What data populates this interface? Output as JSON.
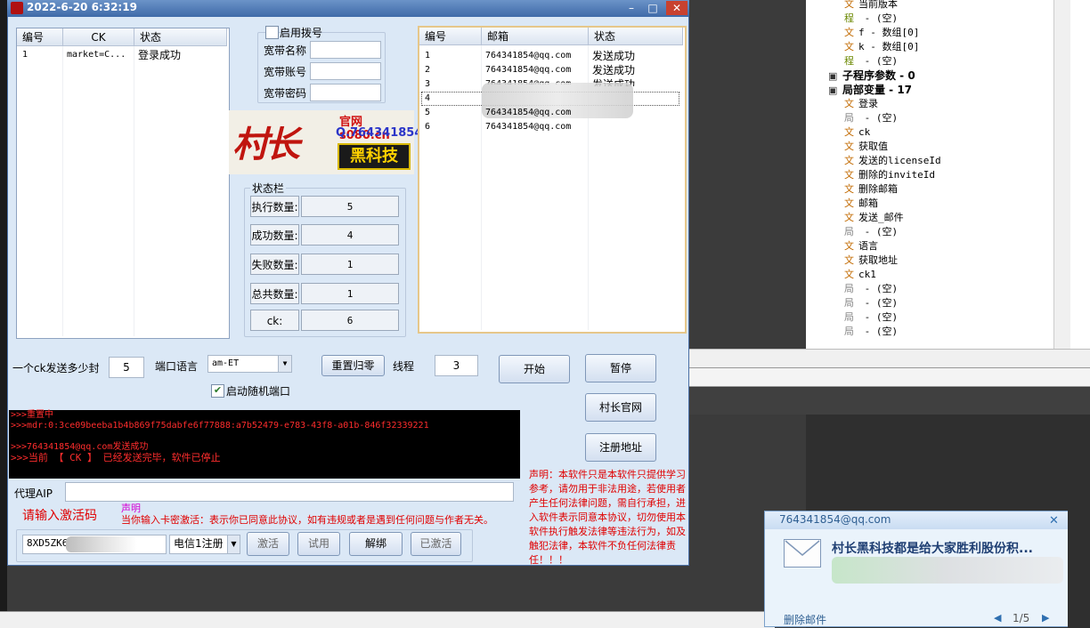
{
  "window": {
    "title": "2022-6-20 6:32:19"
  },
  "ide_tree": [
    {
      "icon": "文",
      "text": "当前版本",
      "type": "str"
    },
    {
      "icon": "程",
      "text": " - (空)",
      "type": "prog"
    },
    {
      "icon": "文",
      "text": "f - 数组[0]",
      "type": "str"
    },
    {
      "icon": "文",
      "text": "k - 数组[0]",
      "type": "str"
    },
    {
      "icon": "程",
      "text": " - (空)",
      "type": "prog"
    },
    {
      "icon": "",
      "text": "子程序参数 - 0",
      "type": "bold"
    },
    {
      "icon": "",
      "text": "局部变量 - 17",
      "type": "bold"
    },
    {
      "icon": "文",
      "text": "登录",
      "type": "str"
    },
    {
      "icon": "局",
      "text": " - (空)",
      "type": "loc"
    },
    {
      "icon": "文",
      "text": "ck",
      "type": "str"
    },
    {
      "icon": "文",
      "text": "获取值",
      "type": "str"
    },
    {
      "icon": "文",
      "text": "发送的licenseId",
      "type": "str"
    },
    {
      "icon": "文",
      "text": "删除的inviteId",
      "type": "str"
    },
    {
      "icon": "文",
      "text": "删除邮箱",
      "type": "str"
    },
    {
      "icon": "文",
      "text": "邮箱",
      "type": "str"
    },
    {
      "icon": "文",
      "text": "发送_邮件",
      "type": "str"
    },
    {
      "icon": "局",
      "text": " - (空)",
      "type": "loc"
    },
    {
      "icon": "文",
      "text": "语言",
      "type": "str"
    },
    {
      "icon": "文",
      "text": "获取地址",
      "type": "str"
    },
    {
      "icon": "文",
      "text": "ck1",
      "type": "str"
    },
    {
      "icon": "局",
      "text": " - (空)",
      "type": "loc"
    },
    {
      "icon": "局",
      "text": " - (空)",
      "type": "loc"
    },
    {
      "icon": "局",
      "text": " - (空)",
      "type": "loc"
    },
    {
      "icon": "局",
      "text": " - (空)",
      "type": "loc"
    }
  ],
  "ck_table": {
    "headers": [
      "编号",
      "CK",
      "状态"
    ],
    "rows": [
      [
        "1",
        "market=C...",
        "登录成功"
      ]
    ]
  },
  "dial": {
    "enable_label": "启用拨号",
    "name_label": "宽带名称",
    "account_label": "宽带账号",
    "password_label": "宽带密码"
  },
  "logo": {
    "site": "官网 s080.cn",
    "qq": "Q.764341854",
    "brand": "村长",
    "tagline": "黑科技"
  },
  "status": {
    "title": "状态栏",
    "items": [
      {
        "label": "执行数量:",
        "value": "5"
      },
      {
        "label": "成功数量:",
        "value": "4"
      },
      {
        "label": "失败数量:",
        "value": "1"
      },
      {
        "label": "总共数量:",
        "value": "1"
      },
      {
        "label": "ck:",
        "value": "6"
      }
    ]
  },
  "mail_table": {
    "headers": [
      "编号",
      "邮箱",
      "状态"
    ],
    "rows": [
      [
        "1",
        "764341854@qq.com",
        "发送成功"
      ],
      [
        "2",
        "764341854@qq.com",
        "发送成功"
      ],
      [
        "3",
        "764341854@qq.com",
        "发送成功"
      ],
      [
        "4",
        "",
        ""
      ],
      [
        "5",
        "764341854@qq.com",
        ""
      ],
      [
        "6",
        "764341854@qq.com",
        ""
      ]
    ]
  },
  "controls": {
    "per_ck_label": "一个ck发送多少封",
    "per_ck_value": "5",
    "lang_label": "端口语言",
    "lang_value": "am-ET",
    "reset_label": "重置归零",
    "thread_label": "线程",
    "thread_value": "3",
    "start_label": "开始",
    "pause_label": "暂停",
    "random_port_label": "启动随机端口",
    "site_label": "村长官网",
    "register_label": "注册地址"
  },
  "console_lines": [
    ">>>重置中",
    ">>>mdr:0:3ce09beeba1b4b869f75dabfe6f77888:a7b52479-e783-43f8-a01b-846f32339221",
    "",
    ">>>764341854@qq.com发送成功",
    ">>>当前  【 CK 】  已经发送完毕，软件已停止"
  ],
  "proxy": {
    "label": "代理AIP",
    "value": ""
  },
  "activation": {
    "prompt": "请输入激活码",
    "notice_title": "声明",
    "notice_text": "当你输入卡密激活：表示你已同意此协议，如有违规或者是遇到任何问题与作者无关。",
    "code_value": "8XD5ZK6",
    "carrier_value": "电信1注册",
    "activate_label": "激活",
    "trial_label": "试用",
    "unbind_label": "解绑",
    "activated_label": "已激活"
  },
  "disclaimer": "声明：本软件只是本软件只提供学习参考，请勿用于非法用途，若使用者产生任何法律问题，需自行承担，进入软件表示同意本协议，切勿使用本软件执行触发法律等违法行为，如及触犯法律，本软件不负任何法律责任！！！",
  "popup": {
    "from": "764341854@qq.com",
    "subject": "村长黑科技都是给大家胜利股份积...",
    "delete_label": "删除邮件",
    "pager": "1/5"
  },
  "colors": {
    "accent": "#3f6aa8",
    "console_text": "#ff2d2d",
    "notice": "#e00000"
  }
}
